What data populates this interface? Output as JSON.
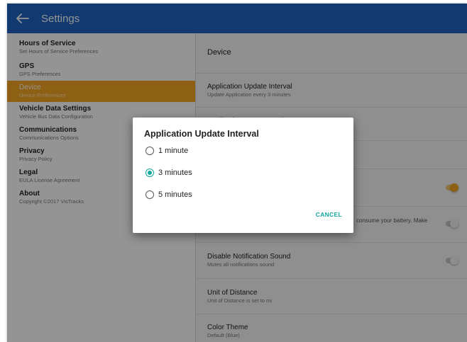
{
  "appbar": {
    "title": "Settings"
  },
  "sidebar": {
    "items": [
      {
        "title": "Hours of Service",
        "subtitle": "Set Hours of Service Preferences"
      },
      {
        "title": "GPS",
        "subtitle": "GPS Preferences"
      },
      {
        "title": "Device",
        "subtitle": "Device Preferences",
        "active": true
      },
      {
        "title": "Vehicle Data Settings",
        "subtitle": "Vehicle Bus Data Configuration"
      },
      {
        "title": "Communications",
        "subtitle": "Communications Options"
      },
      {
        "title": "Privacy",
        "subtitle": "Privacy Policy"
      },
      {
        "title": "Legal",
        "subtitle": "EULA License Agreement"
      },
      {
        "title": "About",
        "subtitle": "Copyright ©2017 VisTracks"
      }
    ]
  },
  "detail": {
    "header": "Device",
    "rows": [
      {
        "title": "Application Update Interval",
        "subtitle": "Update Application every 3 minutes"
      },
      {
        "title": "Application Data Retention",
        "subtitle": ""
      },
      {
        "title": "",
        "subtitle": ""
      },
      {
        "title": "",
        "subtitle": "",
        "switch": "on"
      },
      {
        "title": "",
        "subtitle": "consume your battery. Make",
        "switch": "off"
      },
      {
        "title": "Disable Notification Sound",
        "subtitle": "Mutes all notifications sound",
        "switch": "off"
      },
      {
        "title": "Unit of Distance",
        "subtitle": "Unit of Distance is set to mi"
      },
      {
        "title": "Color Theme",
        "subtitle": "Default (Blue)"
      }
    ]
  },
  "dialog": {
    "title": "Application Update Interval",
    "options": [
      {
        "label": "1 minute",
        "selected": false
      },
      {
        "label": "3 minutes",
        "selected": true
      },
      {
        "label": "5 minutes",
        "selected": false
      }
    ],
    "cancel_label": "CANCEL"
  },
  "colors": {
    "appbar": "#1f65c1",
    "accent": "#f5a623",
    "radio": "#13a89e"
  },
  "icons": {
    "back": "arrow-left"
  }
}
